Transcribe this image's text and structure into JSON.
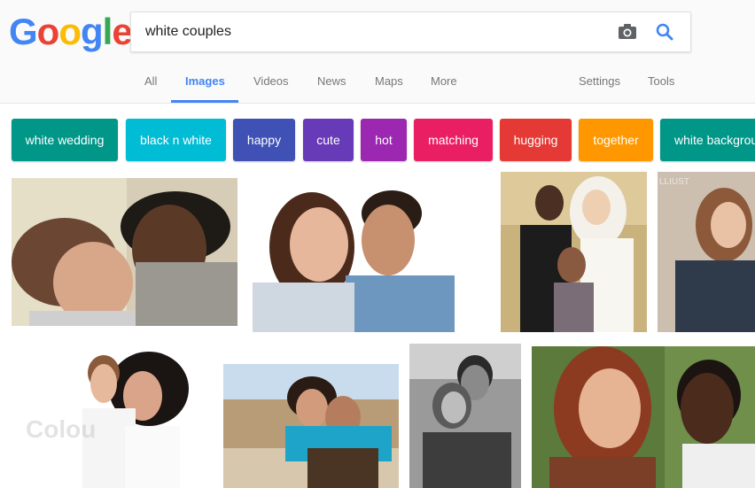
{
  "logo": {
    "letters": [
      "G",
      "o",
      "o",
      "g",
      "l",
      "e"
    ],
    "colors": [
      "#4285F4",
      "#EA4335",
      "#FBBC05",
      "#4285F4",
      "#34A853",
      "#EA4335"
    ]
  },
  "search": {
    "query": "white couples",
    "camera_icon": "camera-icon",
    "search_icon": "magnifier-icon"
  },
  "tabs": [
    "All",
    "Images",
    "Videos",
    "News",
    "Maps",
    "More"
  ],
  "right_tabs": [
    "Settings",
    "Tools"
  ],
  "active_tab": "Images",
  "chips": [
    {
      "label": "white wedding",
      "color": "#009688"
    },
    {
      "label": "black n white",
      "color": "#00BCD4"
    },
    {
      "label": "happy",
      "color": "#3F51B5"
    },
    {
      "label": "cute",
      "color": "#673AB7"
    },
    {
      "label": "hot",
      "color": "#9C27B0"
    },
    {
      "label": "matching",
      "color": "#E91E63"
    },
    {
      "label": "hugging",
      "color": "#E53935"
    },
    {
      "label": "together",
      "color": "#FF9800"
    },
    {
      "label": "white backgrou",
      "color": "#009688"
    }
  ],
  "watermarks": {
    "img5": "Colou",
    "img4": "LLIUST"
  }
}
